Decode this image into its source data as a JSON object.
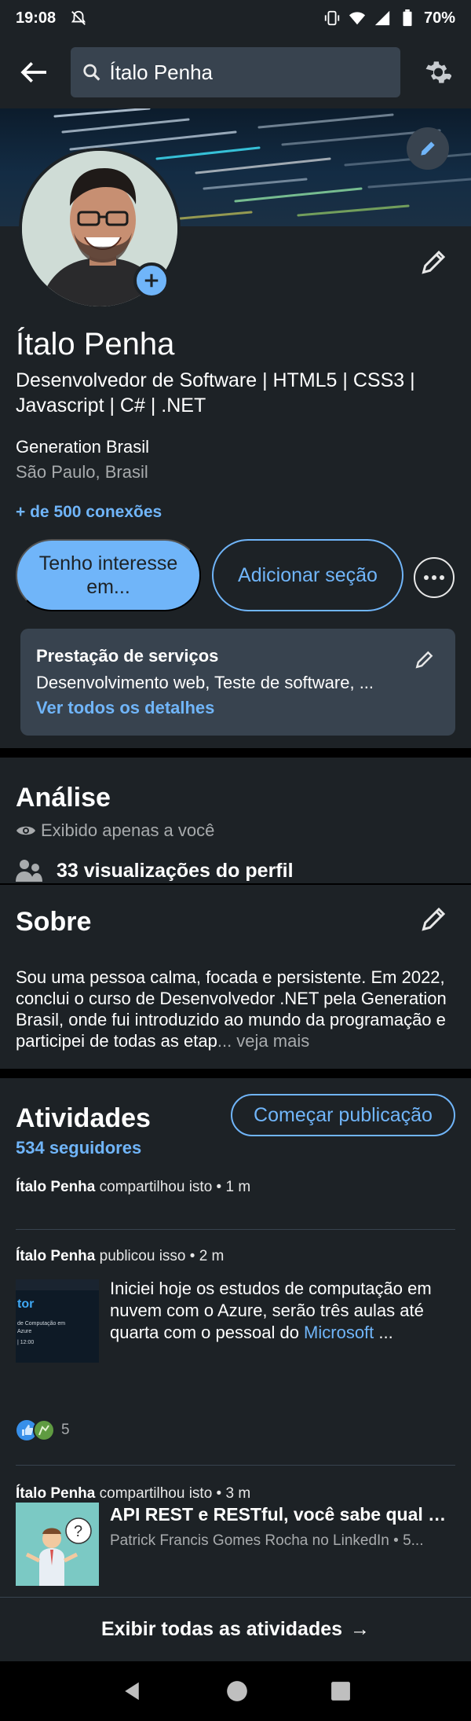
{
  "status_bar": {
    "time": "19:08",
    "battery": "70%",
    "icons": [
      "notifications-off-icon",
      "vibrate-icon",
      "wifi-icon",
      "signal-icon",
      "battery-icon"
    ]
  },
  "top_bar": {
    "search_value": "Ítalo Penha",
    "icons": [
      "back-arrow-icon",
      "search-icon",
      "gear-icon"
    ]
  },
  "profile": {
    "name": "Ítalo Penha",
    "headline": "Desenvolvedor de Software | HTML5 | CSS3 | Javascript | C# | .NET",
    "company": "Generation Brasil",
    "location": "São Paulo, Brasil",
    "connections": "+ de 500 conexões",
    "btn_interest": "Tenho interesse em...",
    "btn_add_section": "Adicionar seção",
    "services": {
      "title": "Prestação de serviços",
      "description": "Desenvolvimento web, Teste de software, ...",
      "link": "Ver todos os detalhes"
    }
  },
  "analytics": {
    "title": "Análise",
    "private_note": "Exibido apenas a você",
    "profile_views": "33 visualizações do perfil"
  },
  "about": {
    "title": "Sobre",
    "text": "Sou uma pessoa calma, focada e persistente. Em 2022, conclui o curso de Desenvolvedor .NET pela Generation Brasil, onde fui introduzido ao mundo da programação e participei de todas as etap",
    "more": "... veja mais"
  },
  "activity": {
    "title": "Atividades",
    "followers": "534 seguidores",
    "btn_start_post": "Começar publicação",
    "items": [
      {
        "author": "Ítalo Penha",
        "action": " compartilhou isto • 1 m"
      },
      {
        "author": "Ítalo Penha",
        "action": " publicou isso • 2 m",
        "text": "Iniciei hoje os estudos de computação em nuvem com o Azure, serão três aulas até quarta com o pessoal do ",
        "link": "Microsoft",
        "ellipsis": " ...",
        "thumb_lines": [
          "tor",
          "de Computação em",
          "Azure",
          "| 12:00"
        ],
        "reaction_count": "5"
      },
      {
        "author": "Ítalo Penha",
        "action": " compartilhou isto • 3 m",
        "share_title": "API REST e RESTful, você sabe qual a di...",
        "share_sub": "Patrick Francis Gomes Rocha no LinkedIn • 5..."
      }
    ],
    "show_all": "Exibir todas as atividades",
    "show_all_arrow": "→"
  }
}
